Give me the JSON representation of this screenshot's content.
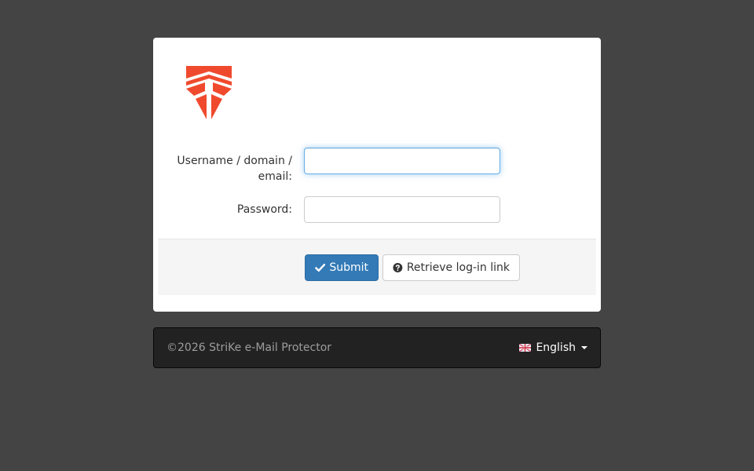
{
  "brand": {
    "logo_icon": "strike-shield-logo-icon",
    "logo_color": "#f04a2e"
  },
  "form": {
    "username_label_line1": "Username / domain /",
    "username_label_line2": "email:",
    "username_value": "",
    "password_label": "Password:",
    "password_value": ""
  },
  "actions": {
    "submit_label": "Submit",
    "submit_icon": "checkmark-icon",
    "retrieve_label": "Retrieve log-in link",
    "retrieve_icon": "question-circle-icon"
  },
  "footer": {
    "copyright": "©2026 StriKe e-Mail Protector",
    "language_label": "English",
    "language_flag": "uk-flag-icon"
  },
  "colors": {
    "background": "#444444",
    "primary": "#337ab7",
    "footer_bg": "#222222"
  }
}
